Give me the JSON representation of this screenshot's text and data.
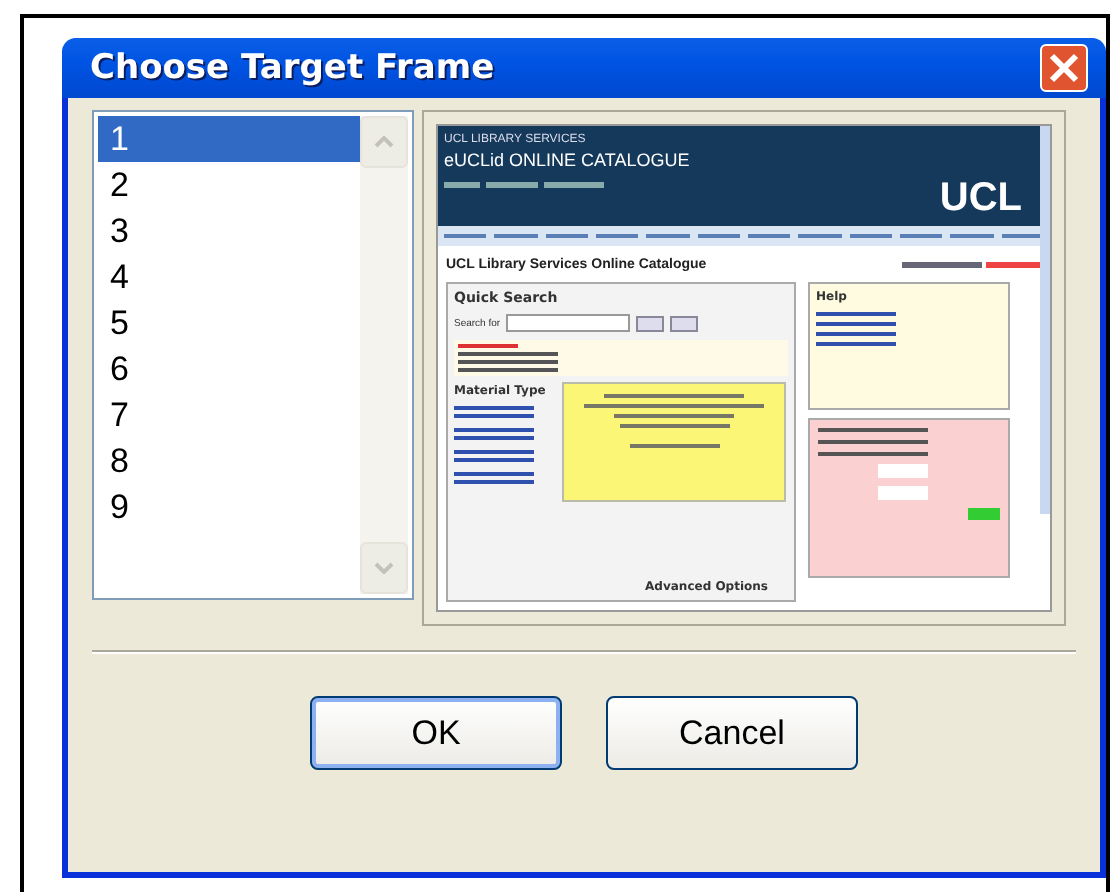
{
  "window": {
    "title": "Choose Target Frame"
  },
  "frames": [
    {
      "label": "1",
      "selected": true
    },
    {
      "label": "2",
      "selected": false
    },
    {
      "label": "3",
      "selected": false
    },
    {
      "label": "4",
      "selected": false
    },
    {
      "label": "5",
      "selected": false
    },
    {
      "label": "6",
      "selected": false
    },
    {
      "label": "7",
      "selected": false
    },
    {
      "label": "8",
      "selected": false
    },
    {
      "label": "9",
      "selected": false
    }
  ],
  "preview": {
    "site_label": "UCL LIBRARY SERVICES",
    "site_title": "eUCLid ONLINE CATALOGUE",
    "logo": "UCL",
    "page_title": "UCL Library Services Online Catalogue",
    "quick_search": "Quick Search",
    "search_label": "Search for",
    "help": "Help",
    "material_search": "Material Type",
    "advanced": "Advanced Options"
  },
  "buttons": [
    {
      "label": "OK",
      "default": true
    },
    {
      "label": "Cancel",
      "default": false
    }
  ]
}
